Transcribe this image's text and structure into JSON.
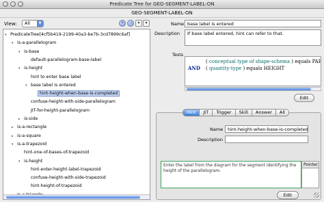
{
  "window": {
    "title": "Predicate Tree for GEO-SEGMENT-LABEL-ON",
    "header": "GEO-SEGMENT-LABEL-ON"
  },
  "left": {
    "view_label": "View:",
    "view_value": "All",
    "toolbar_glyphs": [
      "+",
      "−",
      "▾",
      "▾"
    ],
    "tree": [
      {
        "indent": 0,
        "tri": "▾",
        "text": "PredicateTree[4cf5b419-2199-40a3-be7b-3cd7899c6af]"
      },
      {
        "indent": 1,
        "tri": "▾",
        "text": "is-a-parallelogram"
      },
      {
        "indent": 2,
        "tri": "▾",
        "text": "is-base"
      },
      {
        "indent": 3,
        "tri": "",
        "text": "default-parallelogram-base-label"
      },
      {
        "indent": 2,
        "tri": "▾",
        "text": "is-height"
      },
      {
        "indent": 3,
        "tri": "",
        "text": "hint to enter base label"
      },
      {
        "indent": 3,
        "tri": "▾",
        "text": "base label is entered"
      },
      {
        "indent": 4,
        "tri": "",
        "text": "hint-height-when-base-is-completed",
        "selected": true
      },
      {
        "indent": 3,
        "tri": "",
        "text": "confuse-height-with-side-parallelogram"
      },
      {
        "indent": 3,
        "tri": "",
        "text": "JIT-for-height-parallelogram"
      },
      {
        "indent": 2,
        "tri": "▸",
        "text": "is-side"
      },
      {
        "indent": 1,
        "tri": "▸",
        "text": "is-a-rectangle"
      },
      {
        "indent": 1,
        "tri": "▸",
        "text": "is-a-square"
      },
      {
        "indent": 1,
        "tri": "▾",
        "text": "is-a-trapezoid"
      },
      {
        "indent": 2,
        "tri": "",
        "text": "hint-one-of-bases-of-trapezoid"
      },
      {
        "indent": 2,
        "tri": "▾",
        "text": "is-height"
      },
      {
        "indent": 3,
        "tri": "",
        "text": "hint-enter-height-label-trapezoid"
      },
      {
        "indent": 3,
        "tri": "",
        "text": "confuse-height-with-side-trapezoid"
      },
      {
        "indent": 3,
        "tri": "",
        "text": "hint-height-of-trapezoid"
      },
      {
        "indent": 1,
        "tri": "▸",
        "text": "is-a-triangle"
      }
    ]
  },
  "right": {
    "name_label": "Name",
    "name_value": "base label is entered",
    "description_label": "Description",
    "description_value": "If base label entered, hint can refer to that.",
    "tests_label": "Tests",
    "tests": [
      {
        "prefix": "",
        "open": "(",
        "concept": "conceptual type of shape-schema",
        "close": ")",
        "op": "equals",
        "value": "PAR"
      },
      {
        "prefix": "AND",
        "open": "(",
        "concept": "quantity-type",
        "close": ")",
        "op": "equals",
        "value": "HEIGHT"
      }
    ],
    "edit_label": "Edit",
    "tabs": [
      "Hint",
      "JIT",
      "Trigger",
      "Skill",
      "Answer",
      "All"
    ],
    "active_tab": "Hint",
    "hint_name_label": "Name",
    "hint_name_value": "hint-height-when-base-is-completed",
    "hint_description_label": "Description",
    "hint_description_value": "",
    "hint_text": "Enter the label from the diagram for the segment identifying the height of the parallelogram.",
    "pointer_header": "Pointer",
    "hint_edit_label": "Edit"
  }
}
